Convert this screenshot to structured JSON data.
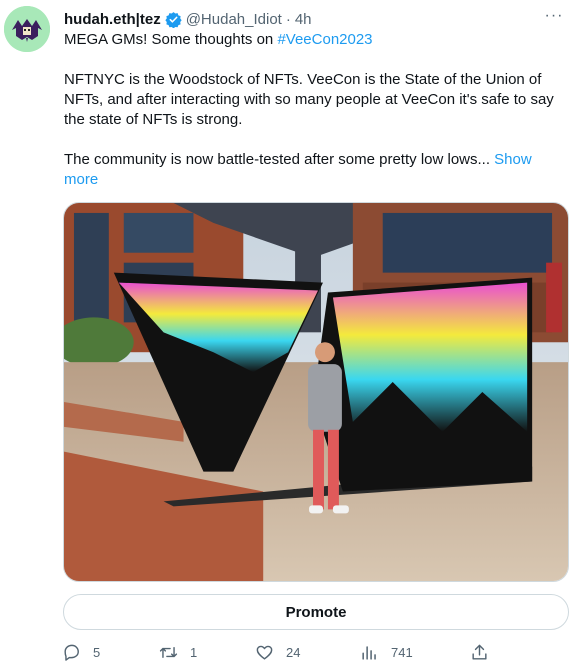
{
  "tweet": {
    "display_name": "hudah.eth|tez",
    "handle": "@Hudah_Idiot",
    "separator": "·",
    "time": "4h",
    "more_label": "···",
    "text_line1_prefix": "MEGA GMs! Some thoughts on ",
    "text_line1_hashtag": "#VeeCon2023",
    "paragraph2": "NFTNYC is the Woodstock of NFTs. VeeCon is the State of the Union of NFTs, and after interacting with so many people at VeeCon it's safe to say the state of NFTs is strong.",
    "paragraph3": "The community is now battle-tested after some pretty low lows... ",
    "show_more": "Show more"
  },
  "promote_label": "Promote",
  "actions": {
    "replies": "5",
    "retweets": "1",
    "likes": "24",
    "views": "741"
  },
  "colors": {
    "link": "#1d9bf0",
    "muted": "#536471",
    "text": "#0f1419",
    "verified": "#1d9bf0",
    "avatar_bg": "#a8e8b8"
  },
  "icons": [
    "more-icon",
    "verified-icon",
    "reply-icon",
    "retweet-icon",
    "like-icon",
    "views-icon",
    "share-icon"
  ]
}
